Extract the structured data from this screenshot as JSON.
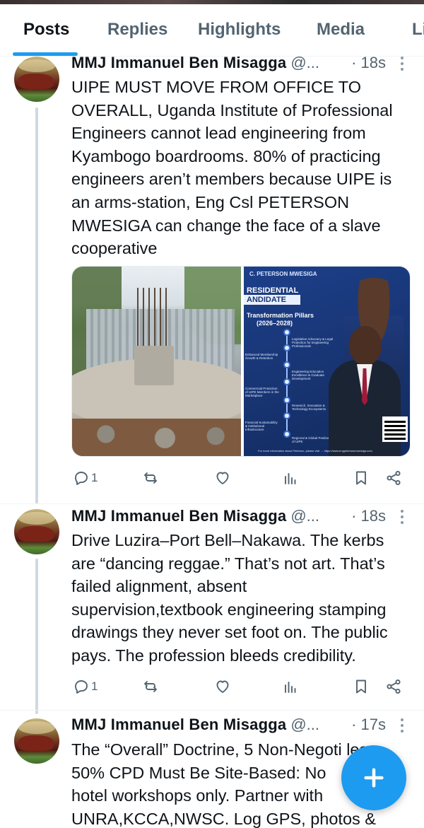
{
  "tabs": [
    {
      "label": "Posts",
      "active": true
    },
    {
      "label": "Replies",
      "active": false
    },
    {
      "label": "Highlights",
      "active": false
    },
    {
      "label": "Media",
      "active": false
    },
    {
      "label": "Li",
      "active": false
    }
  ],
  "accent_color": "#1d9bf0",
  "posts": [
    {
      "name": "MMJ Immanuel Ben Misagga",
      "handle": "@...",
      "time": "· 18s",
      "text": "UIPE MUST MOVE FROM OFFICE TO\nOVERALL, Uganda Institute of Professional\nEngineers cannot lead engineering from\nKyambogo boardrooms. 80% of practicing\nengineers aren’t members because UIPE is\nan arms-station, Eng Csl PETERSON\nMWESIGA can change the face of a slave\ncooperative",
      "reply_count": "1",
      "media": {
        "poster_top": "C. PETERSON MWESIGA",
        "poster_title": "RESIDENTIAL",
        "poster_banner": "ANDIDATE",
        "poster_pillars_title": "Transformation Pillars",
        "poster_years": "(2026–2028)",
        "poster_items": [
          "Legislative Advocacy & Legal Protection for Engineering Professionals",
          "Enhanced Membership Growth & Retention",
          "Engineering Education Excellence & Graduate Development",
          "Commercial Protection of UIPE Members in the Marketplace",
          "Research, Innovation & Technology Ecosystems",
          "Financial Sustainability & Institutional Infrastructure",
          "Regional & Global Positioning of UIPE"
        ],
        "poster_footer": "For more information about Peterson, please visit → https://www.engpetersonmwesiga.com"
      }
    },
    {
      "name": "MMJ Immanuel Ben Misagga",
      "handle": "@...",
      "time": "· 18s",
      "text": "Drive Luzira–Port Bell–Nakawa. The kerbs\nare “dancing reggae.” That’s not art. That’s\nfailed alignment, absent\nsupervision,textbook engineering stamping\ndrawings they never set foot on. The public\npays. The profession bleeds credibility.",
      "reply_count": "1"
    },
    {
      "name": "MMJ Immanuel Ben Misagga",
      "handle": "@...",
      "time": "· 17s",
      "text": "The “Overall” Doctrine, 5 Non-Negoti     les,\n50% CPD Must Be Site-Based: No\nhotel workshops only. Partner with\nUNRA,KCCA,NWSC. Log GPS, photos &"
    }
  ],
  "icons": [
    "reply-icon",
    "repost-icon",
    "like-icon",
    "views-icon",
    "bookmark-icon",
    "share-icon",
    "more-icon",
    "compose-plus-icon"
  ]
}
